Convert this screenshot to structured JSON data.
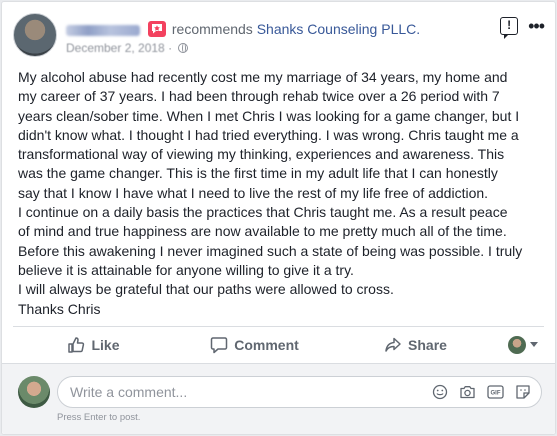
{
  "post": {
    "recommends_text": "recommends",
    "page_name": "Shanks Counseling PLLC.",
    "date": "December 2, 2018",
    "separator": "·",
    "body_lines": [
      "My alcohol abuse had recently cost me my marriage of 34 years, my home and",
      "my career of 37 years. I had been through rehab twice over a 26 period with 7",
      "years clean/sober time. When I met Chris I was looking for a game changer, but I",
      "didn't know what. I thought I had tried everything. I was wrong. Chris taught me a",
      "transformational way of viewing my thinking, experiences and awareness. This",
      "was the game changer. This is the first time in my adult life that I can honestly",
      "say that I know I have what I need to live the rest of my life free of addiction.",
      "I continue on a daily basis the practices that Chris taught me. As a result peace",
      "of mind and true happiness are now available to me pretty much all of the time.",
      "Before this awakening I never imagined such a state of being was possible. I truly",
      "believe it is attainable for anyone willing to give it a try.",
      "I will always be grateful that our paths were allowed to cross.",
      "Thanks Chris"
    ]
  },
  "actions": {
    "like_label": "Like",
    "comment_label": "Comment",
    "share_label": "Share"
  },
  "comment": {
    "placeholder": "Write a comment...",
    "hint": "Press Enter to post.",
    "gif_label": "GIF"
  },
  "colors": {
    "link": "#385898",
    "recommend_badge": "#f3425f",
    "muted": "#606770"
  },
  "icons": [
    "recommend-icon",
    "globe-icon",
    "report-icon",
    "more-icon",
    "like-icon",
    "comment-icon",
    "share-icon",
    "emoji-icon",
    "camera-icon",
    "gif-icon",
    "sticker-icon"
  ]
}
